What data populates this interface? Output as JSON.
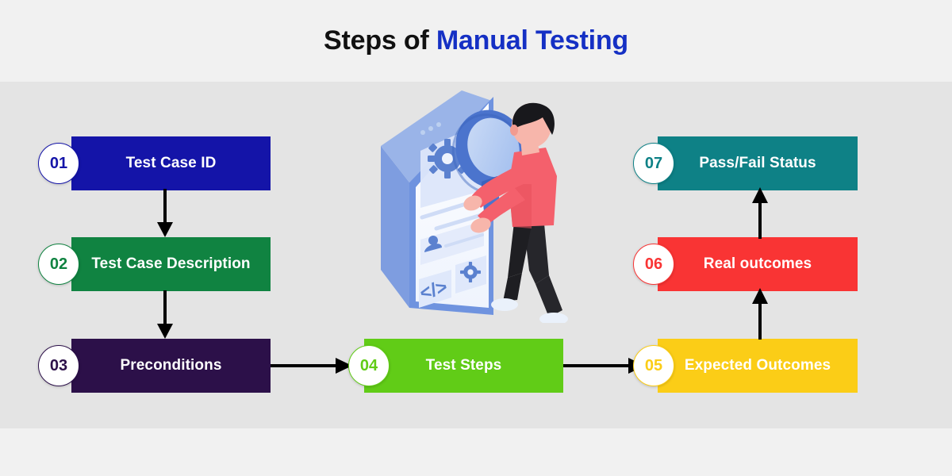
{
  "header": {
    "title_plain": "Steps of ",
    "title_accent": "Manual Testing",
    "accent_color": "#1530c4"
  },
  "steps": [
    {
      "number": "01",
      "label": "Test Case ID",
      "color": "#1414a8",
      "column": "left"
    },
    {
      "number": "02",
      "label": "Test Case Description",
      "color": "#108341",
      "column": "left"
    },
    {
      "number": "03",
      "label": "Preconditions",
      "color": "#2c1049",
      "column": "left"
    },
    {
      "number": "04",
      "label": "Test Steps",
      "color": "#61cc17",
      "column": "center"
    },
    {
      "number": "05",
      "label": "Expected Outcomes",
      "color": "#fbcd17",
      "column": "right"
    },
    {
      "number": "06",
      "label": "Real outcomes",
      "color": "#f93434",
      "column": "right"
    },
    {
      "number": "07",
      "label": "Pass/Fail Status",
      "color": "#0e8186",
      "column": "right"
    }
  ],
  "flow": {
    "connections": [
      {
        "from": "01",
        "to": "02",
        "direction": "down"
      },
      {
        "from": "02",
        "to": "03",
        "direction": "down"
      },
      {
        "from": "03",
        "to": "04",
        "direction": "right"
      },
      {
        "from": "04",
        "to": "05",
        "direction": "right"
      },
      {
        "from": "05",
        "to": "06",
        "direction": "up"
      },
      {
        "from": "06",
        "to": "07",
        "direction": "up"
      }
    ],
    "arrow_color": "#000000"
  },
  "illustration": {
    "name": "manual-testing-illustration",
    "description": "isometric tablet with magnifying glass and person inspecting",
    "screen_icons": [
      "gear-icon",
      "user-icon",
      "code-brackets-icon",
      "gear-icon-small"
    ],
    "code_glyph": "</>",
    "palette": {
      "device_edge": "#6f93df",
      "device_face": "#fbfdff",
      "card_fill": "#dce6fa",
      "icon_blue": "#5b81cf",
      "lens_ring": "#4b74cd",
      "lens_glass": "#b9cdf0",
      "shirt": "#f4606c",
      "pants": "#1e1e22",
      "skin": "#f7b6ab",
      "hair": "#18181c",
      "shoes": "#eaf1fb"
    }
  },
  "canvas": {
    "page_bg": "#f1f1f1",
    "band_bg": "#e4e4e4"
  }
}
